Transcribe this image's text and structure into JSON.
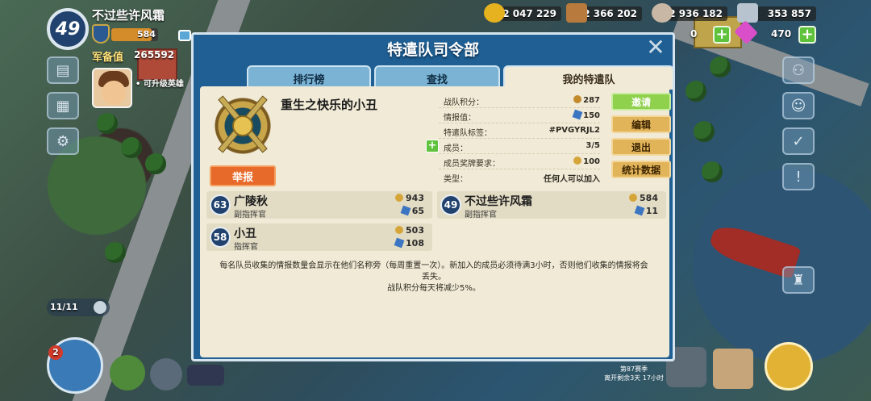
{
  "player": {
    "level": "49",
    "name": "不过些许风霜",
    "medals": "584",
    "army_label": "军备值",
    "army_value": "265592",
    "hero_note": "• 可升级英雄"
  },
  "resources": [
    {
      "name": "gold",
      "value": "2 047 229",
      "color": "#e6b21f"
    },
    {
      "name": "wood",
      "value": "2 366 202",
      "color": "#b87a3d"
    },
    {
      "name": "stone",
      "value": "2 936 182",
      "color": "#c9b7a5"
    },
    {
      "name": "iron",
      "value": "353 857",
      "color": "#b7c3cf"
    }
  ],
  "secondary_resources": {
    "a_value": "0",
    "diamonds": "470"
  },
  "left_hud": {
    "builders": "11/11",
    "hammer_badge": "2"
  },
  "bottom_note": {
    "line1": "第87赛季",
    "line2": "离开剩余3天 17小时"
  },
  "modal": {
    "title": "特遣队司令部",
    "tabs": [
      {
        "label": "排行榜",
        "active": false
      },
      {
        "label": "查找",
        "active": false
      },
      {
        "label": "我的特遣队",
        "active": true
      }
    ],
    "squad_name": "重生之快乐的小丑",
    "report_label": "举报",
    "stats": [
      {
        "key": "战队积分：",
        "value": "287",
        "icon": "medal"
      },
      {
        "key": "情报值：",
        "value": "150",
        "icon": "intel"
      },
      {
        "key": "特遣队标签：",
        "value": "#PVGYRJL2",
        "icon": ""
      },
      {
        "key": "成员：",
        "value": "3/5",
        "icon": ""
      },
      {
        "key": "成员奖牌要求：",
        "value": "100",
        "icon": "goldmedal"
      },
      {
        "key": "类型：",
        "value": "任何人可以加入",
        "icon": ""
      }
    ],
    "actions": [
      "邀请",
      "编辑",
      "退出",
      "统计数据"
    ],
    "members": [
      {
        "level": "63",
        "name": "广陵秋",
        "role": "副指挥官",
        "medals": "943",
        "intel": "65"
      },
      {
        "level": "49",
        "name": "不过些许风霜",
        "role": "副指挥官",
        "medals": "584",
        "intel": "11"
      },
      {
        "level": "58",
        "name": "小丑",
        "role": "指挥官",
        "medals": "503",
        "intel": "108"
      }
    ],
    "info_line1": "每名队员收集的情报数量会显示在他们名称旁（每周重置一次）。新加入的成员必须待满3小时，否则他们收集的情报将会",
    "info_line2": "丢失。",
    "info_line3": "战队积分每天将减少5%。"
  }
}
